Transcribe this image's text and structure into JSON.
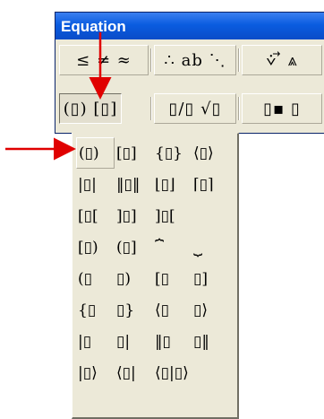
{
  "window": {
    "title": "Equation"
  },
  "toolbar": {
    "row1": [
      {
        "id": "relational",
        "label": "≤ ≠ ≈"
      },
      {
        "id": "spaces",
        "label": "∴ ab ⋱"
      },
      {
        "id": "embellishments",
        "label": "⩒ ⃗ ⩓"
      }
    ],
    "row2": [
      {
        "id": "fence",
        "label": "(▯) [▯]",
        "pressed": true
      },
      {
        "id": "fraction",
        "label": "▯/▯ √▯"
      },
      {
        "id": "subscript",
        "label": "▯▪ ▯"
      }
    ]
  },
  "palette": {
    "rows": [
      [
        "(▯)",
        "[▯]",
        "{▯}",
        "⟨▯⟩"
      ],
      [
        "|▯|",
        "‖▯‖",
        "⌊▯⌋",
        "⌈▯⌉"
      ],
      [
        "[▯[",
        "]▯]",
        "]▯[",
        ""
      ],
      [
        "[▯)",
        "(▯]",
        "⏞",
        "⏟"
      ],
      [
        "(▯",
        "▯)",
        "[▯",
        "▯]"
      ],
      [
        "{▯",
        "▯}",
        "⟨▯",
        "▯⟩"
      ],
      [
        "|▯",
        "▯|",
        "‖▯",
        "▯‖"
      ],
      [
        "|▯⟩",
        "⟨▯|",
        "⟨▯|▯⟩",
        ""
      ]
    ]
  },
  "colors": {
    "arrow": "#e00000",
    "title_bar": "#0a5ce0",
    "face": "#ece9d8"
  }
}
